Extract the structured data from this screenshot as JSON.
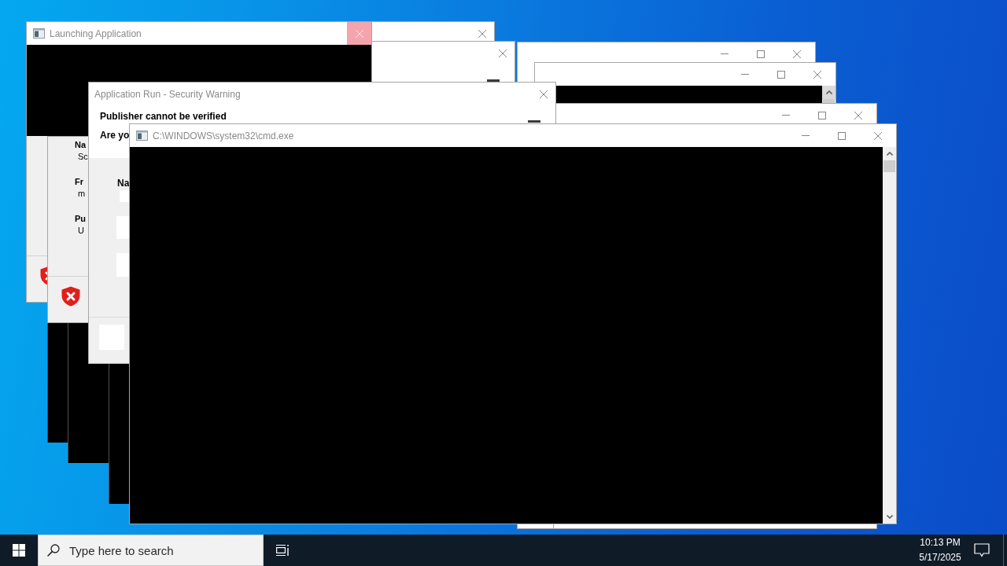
{
  "desktop": {
    "windows": [
      {
        "kind": "console_body"
      },
      {
        "kind": "console_body"
      },
      {
        "kind": "console_body"
      },
      {
        "kind": "titlebar",
        "close_hovered": false
      },
      {
        "kind": "dialog",
        "close_hovered": false
      },
      {
        "kind": "window",
        "close_hovered": false
      },
      {
        "kind": "console_top",
        "close_hovered": false
      },
      {
        "kind": "window",
        "close_hovered": false
      },
      {
        "kind": "launcher",
        "title": "Launching Application",
        "close_hovered": true
      },
      {
        "kind": "details",
        "rows": [
          {
            "label": "Na",
            "value": "Sc"
          },
          {
            "label": "Fr",
            "value": "m"
          },
          {
            "label": "Pu",
            "value": "U"
          }
        ]
      },
      {
        "kind": "security_warning",
        "title": "Application Run - Security Warning",
        "heading": "Publisher cannot be verified",
        "question": "Are yo",
        "field_label": "Na",
        "close_hovered": false
      },
      {
        "kind": "console",
        "title": "C:\\WINDOWS\\system32\\cmd.exe",
        "close_hovered": false
      }
    ]
  },
  "taskbar": {
    "search": {
      "placeholder": "Type here to search"
    },
    "clock": {
      "time": "10:13 PM",
      "date": "5/17/2025"
    }
  }
}
